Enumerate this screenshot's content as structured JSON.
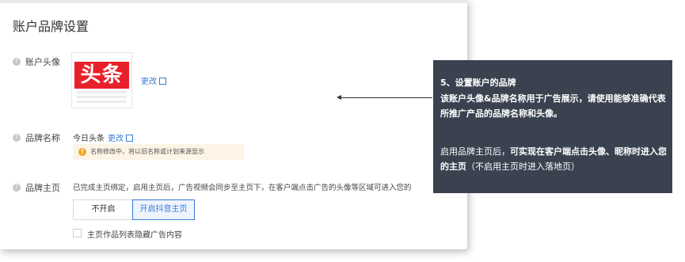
{
  "page_title": "账户品牌设置",
  "rows": {
    "avatar": {
      "label": "账户头像",
      "edit_link": "更改"
    },
    "brand_name": {
      "label": "品牌名称",
      "value": "今日头条",
      "edit_link": "更改"
    },
    "brand_home": {
      "label": "品牌主页"
    }
  },
  "logo_text": "头条",
  "notice": {
    "text": "名称修改中，将以旧名称或计划来源显示"
  },
  "brand_home": {
    "description": "已完成主页绑定，启用主页后，广告视频会同步至主页下，在客户端点击广告的头像等区域可进入您的",
    "buttons": {
      "off": "不开启",
      "on": "开启抖音主页"
    },
    "checkbox_label": "主页作品列表隐藏广告内容"
  },
  "callout": {
    "title": "5、设置账户的品牌",
    "body1": "该账户头像&品牌名称用于广告展示，请使用能够准确代表所推广产品的品牌名称和头像。",
    "body2_prefix": "启用品牌主页后，",
    "body2_bold": "可实现在客户端点击头像、昵称时进入您的主页",
    "body2_suffix": "（不启用主页时进入落地页）"
  },
  "colors": {
    "accent": "#3a7bd5",
    "callout_bg": "#3a4250",
    "logo_red": "#e8202a",
    "warning": "#f5a623"
  },
  "icons": [
    "help-icon",
    "external-link-icon",
    "warning-icon",
    "arrow-left-icon"
  ]
}
